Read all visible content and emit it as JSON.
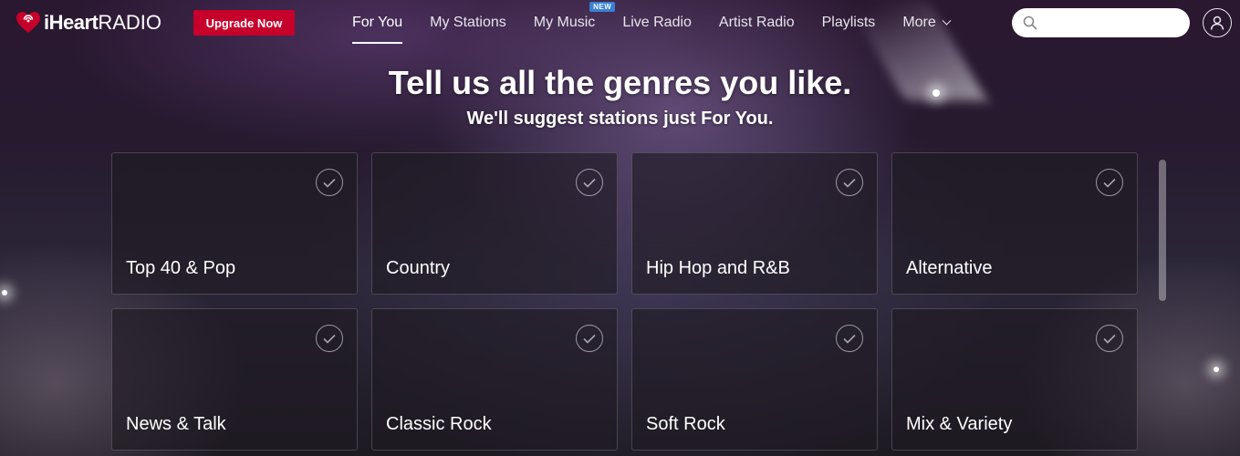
{
  "header": {
    "logo": {
      "brand_bold": "iHeart",
      "brand_light": "RADIO"
    },
    "upgrade_label": "Upgrade Now",
    "nav": [
      {
        "label": "For You",
        "active": true
      },
      {
        "label": "My Stations"
      },
      {
        "label": "My Music",
        "badge": "NEW"
      },
      {
        "label": "Live Radio"
      },
      {
        "label": "Artist Radio"
      },
      {
        "label": "Playlists"
      },
      {
        "label": "More"
      }
    ],
    "search": {
      "placeholder": "",
      "value": "",
      "icon": "search-icon"
    },
    "user_icon": "user-icon"
  },
  "main": {
    "headline": "Tell us all the genres you like.",
    "subhead": "We'll suggest stations just For You.",
    "genres": [
      {
        "label": "Top 40 & Pop",
        "selected": false
      },
      {
        "label": "Country",
        "selected": false
      },
      {
        "label": "Hip Hop and R&B",
        "selected": false
      },
      {
        "label": "Alternative",
        "selected": false
      },
      {
        "label": "News & Talk",
        "selected": false
      },
      {
        "label": "Classic Rock",
        "selected": false
      },
      {
        "label": "Soft Rock",
        "selected": false
      },
      {
        "label": "Mix & Variety",
        "selected": false
      }
    ]
  },
  "colors": {
    "brand_red": "#c6002b",
    "new_badge": "#3a7fd6",
    "text": "#ffffff"
  }
}
